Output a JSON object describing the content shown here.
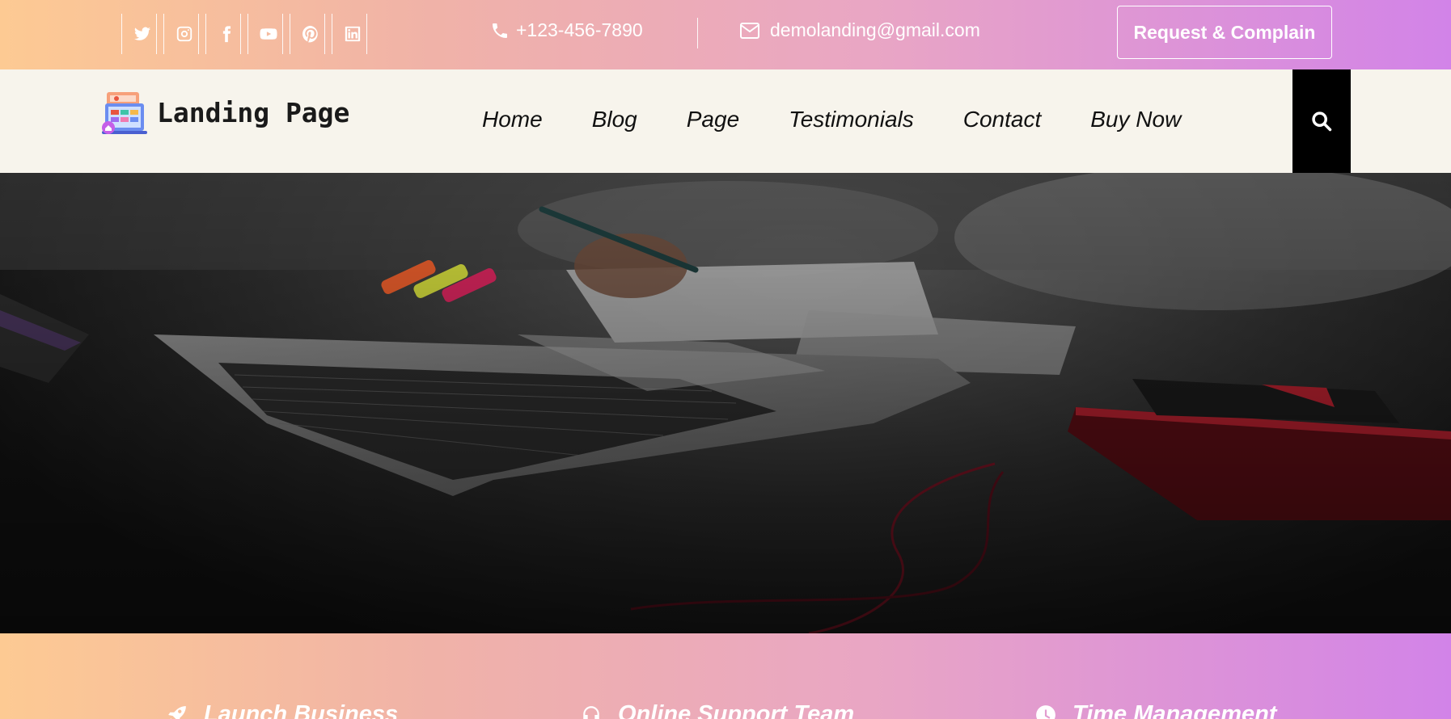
{
  "topbar": {
    "socials": [
      {
        "icon": "twitter-icon"
      },
      {
        "icon": "instagram-icon"
      },
      {
        "icon": "facebook-icon"
      },
      {
        "icon": "youtube-icon"
      },
      {
        "icon": "pinterest-icon"
      },
      {
        "icon": "linkedin-icon"
      }
    ],
    "phone": "+123-456-7890",
    "email": "demolanding@gmail.com",
    "request_button": "Request & Complain"
  },
  "navbar": {
    "logo_text": "Landing Page",
    "items": [
      "Home",
      "Blog",
      "Page",
      "Testimonials",
      "Contact",
      "Buy Now"
    ]
  },
  "features": [
    {
      "icon": "rocket-icon",
      "label": "Launch Business"
    },
    {
      "icon": "headset-icon",
      "label": "Online Support Team"
    },
    {
      "icon": "clock-icon",
      "label": "Time Management"
    }
  ],
  "colors": {
    "gradient_start": "#fdca93",
    "gradient_end": "#d283e8",
    "nav_bg": "#f7f4ec"
  }
}
